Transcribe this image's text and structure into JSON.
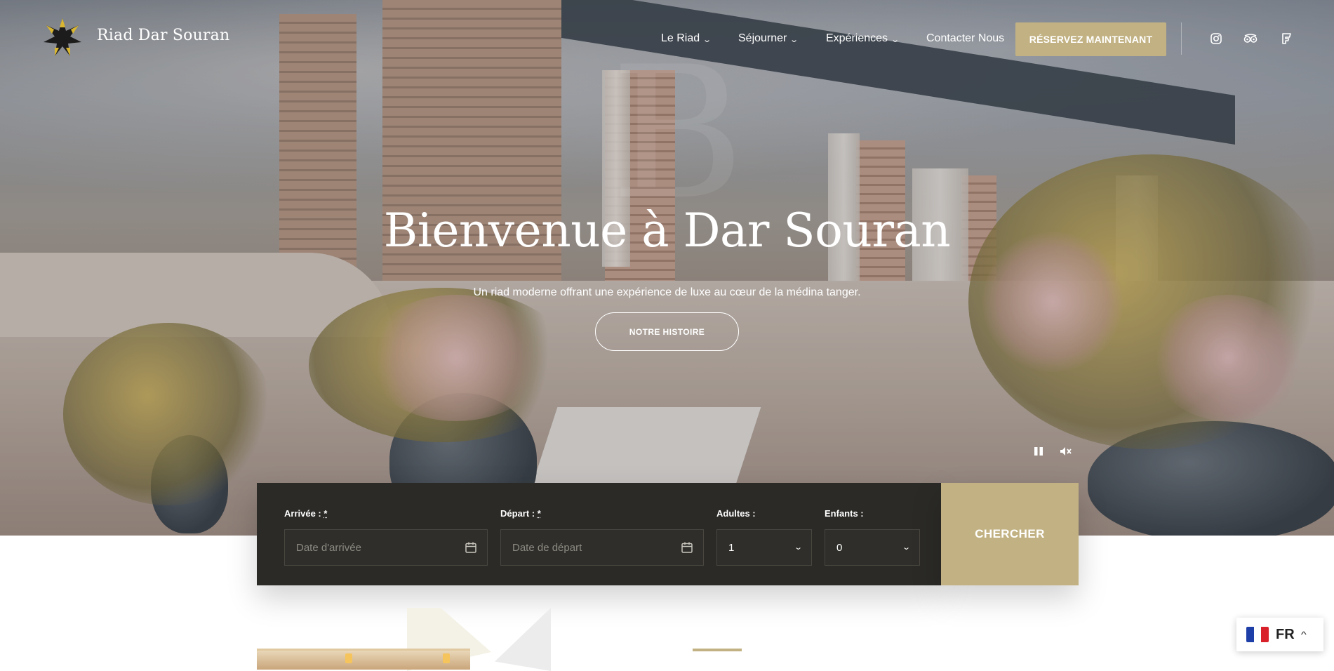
{
  "brand": {
    "name": "Riad Dar Souran",
    "logo_icon": "star-logo-icon"
  },
  "nav": {
    "items": [
      {
        "label": "Le Riad",
        "has_dropdown": true
      },
      {
        "label": "Séjourner",
        "has_dropdown": true
      },
      {
        "label": "Expériences",
        "has_dropdown": true
      },
      {
        "label": "Contacter Nous",
        "has_dropdown": false
      }
    ],
    "book_label": "RÉSERVEZ MAINTENANT",
    "social_icons": [
      "instagram-icon",
      "tripadvisor-icon",
      "foursquare-icon"
    ]
  },
  "hero": {
    "title": "Bienvenue à Dar Souran",
    "subtitle": "Un riad moderne offrant une expérience de luxe au cœur de la médina tanger.",
    "story_button": "NOTRE HISTOIRE",
    "controls": [
      "pause-icon",
      "mute-icon"
    ]
  },
  "booking": {
    "arrival": {
      "label": "Arrivée :",
      "required_mark": "*",
      "placeholder": "Date d'arrivée"
    },
    "departure": {
      "label": "Départ :",
      "required_mark": "*",
      "placeholder": "Date de départ"
    },
    "adults": {
      "label": "Adultes :",
      "value": "1"
    },
    "children": {
      "label": "Enfants :",
      "value": "0"
    },
    "search_label": "CHERCHER"
  },
  "language": {
    "code": "FR",
    "flag": "france-flag-icon"
  },
  "colors": {
    "accent": "#c2b283",
    "dark_panel": "#2b2a27"
  }
}
